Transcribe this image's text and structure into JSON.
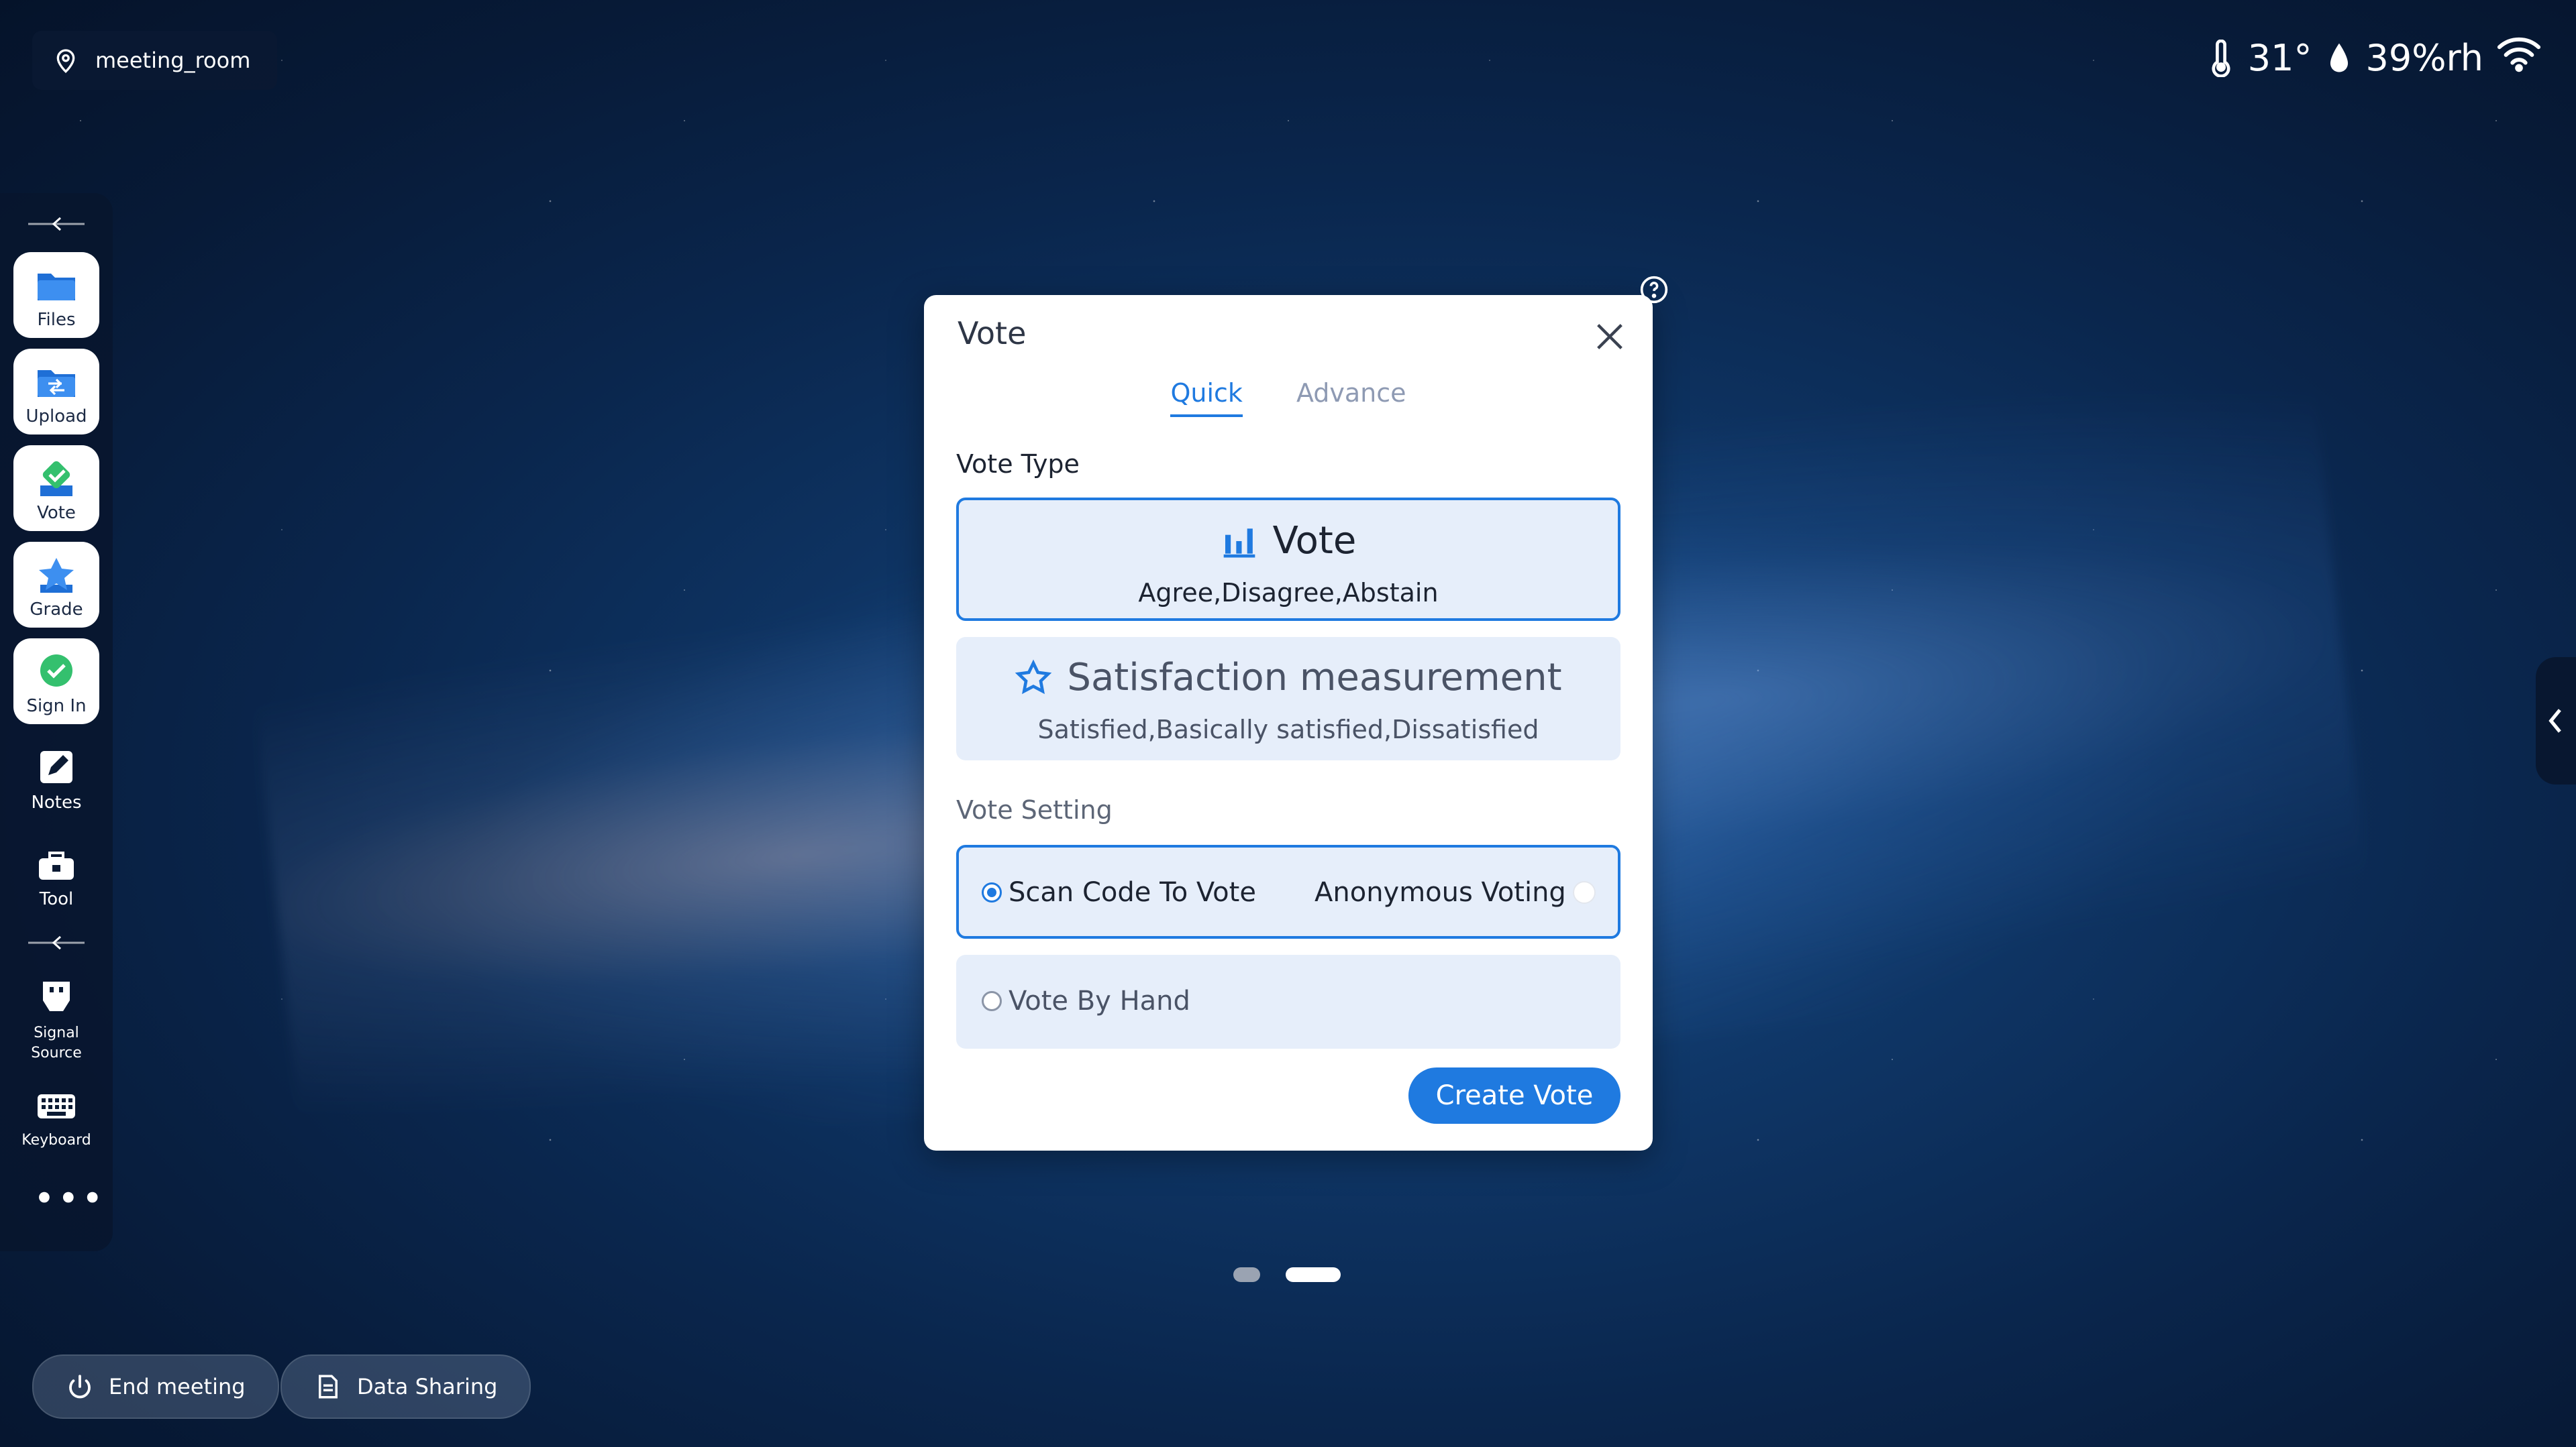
{
  "location": {
    "name": "meeting_room",
    "icon": "location-pin-icon"
  },
  "status": {
    "temperature": "31°",
    "humidity": "39%rh"
  },
  "sidebar": {
    "items": [
      {
        "label": "Files",
        "icon": "folder-icon"
      },
      {
        "label": "Upload",
        "icon": "upload-folder-icon"
      },
      {
        "label": "Vote",
        "icon": "vote-check-icon"
      },
      {
        "label": "Grade",
        "icon": "star-icon"
      },
      {
        "label": "Sign In",
        "icon": "sign-in-check-icon"
      },
      {
        "label": "Notes",
        "icon": "edit-note-icon"
      },
      {
        "label": "Tool",
        "icon": "toolbox-icon"
      }
    ],
    "secondary": [
      {
        "label_line1": "Signal",
        "label_line2": "Source",
        "icon": "hdmi-icon"
      },
      {
        "label": "Keyboard",
        "icon": "keyboard-icon"
      }
    ],
    "more": "•••"
  },
  "dialog": {
    "title": "Vote",
    "tabs": [
      {
        "label": "Quick",
        "active": true
      },
      {
        "label": "Advance",
        "active": false
      }
    ],
    "vote_type_label": "Vote Type",
    "types": [
      {
        "title": "Vote",
        "subtitle": "Agree,Disagree,Abstain",
        "selected": true,
        "icon": "bar-chart-icon"
      },
      {
        "title": "Satisfaction measurement",
        "subtitle": "Satisfied,Basically satisfied,Dissatisfied",
        "selected": false,
        "icon": "star-outline-icon"
      }
    ],
    "setting_label": "Vote Setting",
    "settings": {
      "scan_code": "Scan Code To Vote",
      "anonymous": "Anonymous Voting",
      "by_hand": "Vote By Hand"
    },
    "create_button": "Create Vote"
  },
  "pager": {
    "pages": 2,
    "current": 2
  },
  "bottom": {
    "end_meeting": "End meeting",
    "data_sharing": "Data Sharing"
  },
  "colors": {
    "accent": "#1f7ae0",
    "card_bg": "#e6eefa",
    "sidebar_bg": "#08162d"
  }
}
